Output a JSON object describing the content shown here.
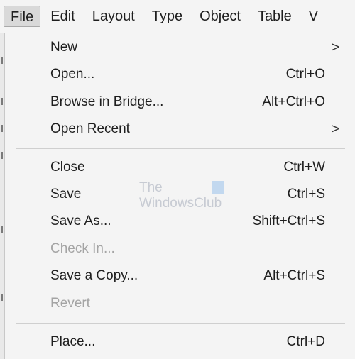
{
  "menubar": {
    "items": [
      {
        "label": "File"
      },
      {
        "label": "Edit"
      },
      {
        "label": "Layout"
      },
      {
        "label": "Type"
      },
      {
        "label": "Object"
      },
      {
        "label": "Table"
      },
      {
        "label": "Vi"
      }
    ]
  },
  "file_menu": {
    "items": [
      {
        "label": "New",
        "shortcut": "",
        "submenu": true,
        "disabled": false
      },
      {
        "label": "Open...",
        "shortcut": "Ctrl+O",
        "submenu": false,
        "disabled": false
      },
      {
        "label": "Browse in Bridge...",
        "shortcut": "Alt+Ctrl+O",
        "submenu": false,
        "disabled": false
      },
      {
        "label": "Open Recent",
        "shortcut": "",
        "submenu": true,
        "disabled": false
      },
      {
        "label": "Close",
        "shortcut": "Ctrl+W",
        "submenu": false,
        "disabled": false
      },
      {
        "label": "Save",
        "shortcut": "Ctrl+S",
        "submenu": false,
        "disabled": false
      },
      {
        "label": "Save As...",
        "shortcut": "Shift+Ctrl+S",
        "submenu": false,
        "disabled": false
      },
      {
        "label": "Check In...",
        "shortcut": "",
        "submenu": false,
        "disabled": true
      },
      {
        "label": "Save a Copy...",
        "shortcut": "Alt+Ctrl+S",
        "submenu": false,
        "disabled": false
      },
      {
        "label": "Revert",
        "shortcut": "",
        "submenu": false,
        "disabled": true
      },
      {
        "label": "Place...",
        "shortcut": "Ctrl+D",
        "submenu": false,
        "disabled": false
      }
    ],
    "submenu_glyph": ">"
  },
  "watermark": {
    "line1": "The",
    "line2": "WindowsClub"
  }
}
